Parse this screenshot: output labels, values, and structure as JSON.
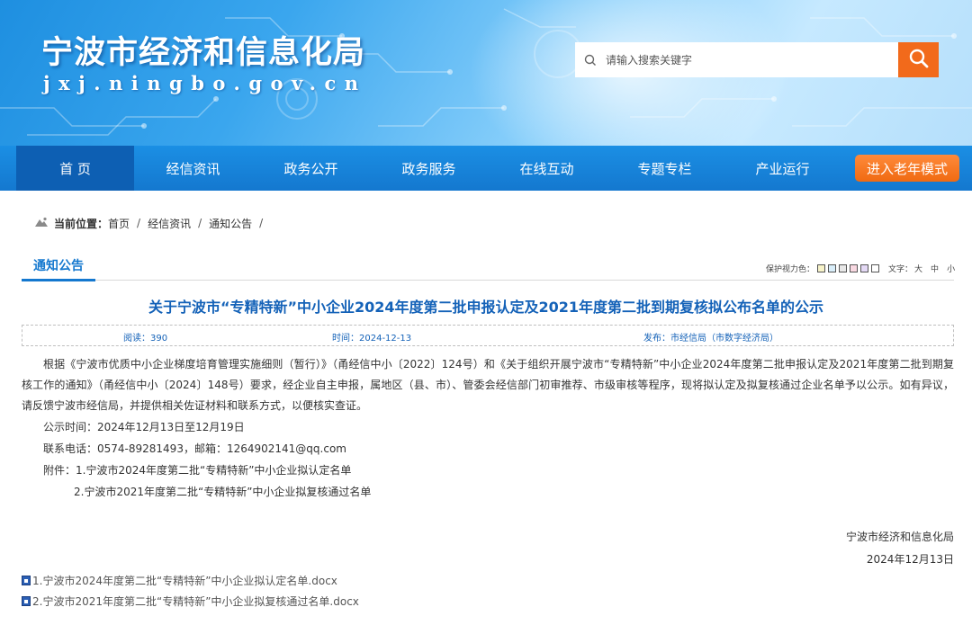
{
  "header": {
    "site_name": "宁波市经济和信息化局",
    "domain": "jxj.ningbo.gov.cn",
    "search_placeholder": "请输入搜索关键字"
  },
  "nav": {
    "items": [
      "首 页",
      "经信资讯",
      "政务公开",
      "政务服务",
      "在线互动",
      "专题专栏",
      "产业运行"
    ],
    "elder_mode": "进入老年模式"
  },
  "breadcrumb": {
    "label": "当前位置：",
    "items": [
      "首页",
      "经信资讯",
      "通知公告"
    ],
    "separator": "/"
  },
  "section": {
    "title": "通知公告",
    "eye_label": "保护视力色：",
    "eye_colors": [
      "#f7f3c9",
      "#d9eefa",
      "#e8e8e8",
      "#f9d9e2",
      "#e4d9f5",
      "#ffffff"
    ],
    "font_label": "文字：",
    "font_sizes": [
      "大",
      "中",
      "小"
    ]
  },
  "article": {
    "title": "关于宁波市“专精特新”中小企业2024年度第二批申报认定及2021年度第二批到期复核拟公布名单的公示",
    "views": "阅读：390",
    "time": "时间：2024-12-13",
    "publisher": "发布：市经信局（市数字经济局）",
    "paragraph": "根据《宁波市优质中小企业梯度培育管理实施细则（暂行）》（甬经信中小〔2022〕124号）和《关于组织开展宁波市“专精特新”中小企业2024年度第二批申报认定及2021年度第二批到期复核工作的通知》（甬经信中小〔2024〕148号）要求，经企业自主申报，属地区（县、市）、管委会经信部门初审推荐、市级审核等程序，现将拟认定及拟复核通过企业名单予以公示。如有异议，请反馈宁波市经信局，并提供相关佐证材料和联系方式，以便核实查证。",
    "period": "公示时间：2024年12月13日至12月19日",
    "contact": "联系电话：0574-89281493，邮箱：1264902141@qq.com",
    "attach_line1": "附件：1.宁波市2024年度第二批“专精特新”中小企业拟认定名单",
    "attach_line2": "2.宁波市2021年度第二批“专精特新”中小企业拟复核通过名单",
    "sign_org": "宁波市经济和信息化局",
    "sign_date": "2024年12月13日"
  },
  "attachments": [
    "1.宁波市2024年度第二批“专精特新”中小企业拟认定名单.docx",
    "2.宁波市2021年度第二批“专精特新”中小企业拟复核通过名单.docx"
  ]
}
